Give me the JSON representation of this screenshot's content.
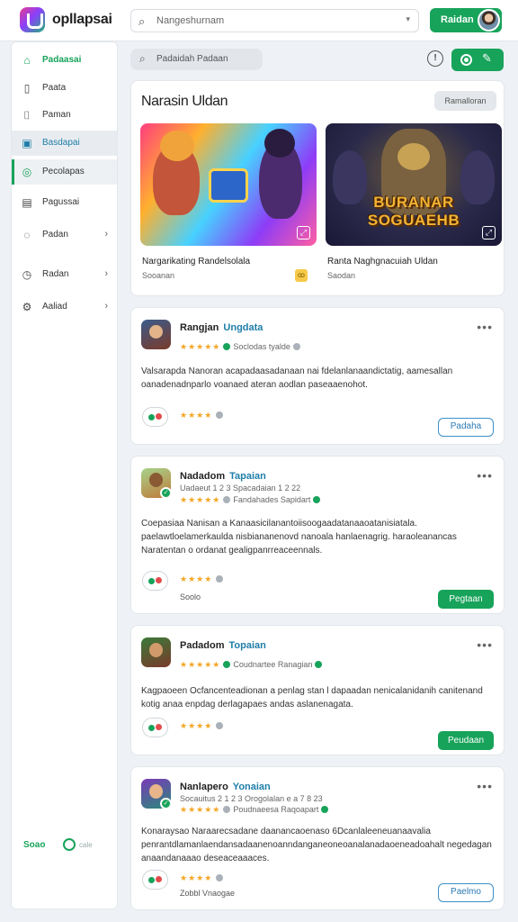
{
  "header": {
    "brand": "opllapsai",
    "search_placeholder": "Nangeshurnam",
    "action_label": "Raidan"
  },
  "sidebar": {
    "items": [
      {
        "label": "Padaasai",
        "icon": "home-icon",
        "arrow": ""
      },
      {
        "label": "Paata",
        "icon": "document-icon",
        "arrow": ""
      },
      {
        "label": "Paman",
        "icon": "folder-icon",
        "arrow": ""
      },
      {
        "label": "Basdapai",
        "icon": "calendar-icon",
        "arrow": ""
      },
      {
        "label": "Pecolapas",
        "icon": "shield-icon",
        "arrow": ""
      },
      {
        "label": "Pagussai",
        "icon": "list-icon",
        "arrow": ""
      },
      {
        "label": "Padan",
        "icon": "settings-icon",
        "arrow": "›"
      },
      {
        "label": "Radan",
        "icon": "clock-icon",
        "arrow": "›"
      },
      {
        "label": "Aaliad",
        "icon": "gear-icon",
        "arrow": "›"
      }
    ],
    "footer_label": "Soao",
    "footer_sub": "cale"
  },
  "toolbar": {
    "filter_placeholder": "Padaidah Padaan",
    "info_glyph": "!"
  },
  "featured": {
    "title": "Narasin Uldan",
    "button": "Ramalloran",
    "games": [
      {
        "name": "Nargarikating Randelsolala",
        "sub": "Sooanan",
        "badge": "ꝏ"
      },
      {
        "name": "Ranta Naghgnacuiah Uldan",
        "sub": "Saodan",
        "badge": ""
      }
    ],
    "game2_logo_text": "BURANAR SOGUAEHB"
  },
  "reviews": [
    {
      "name": "Rangjan",
      "tag": "Ungdata",
      "meta": "",
      "source": "Soclodas tyalde",
      "body": "Valsarapda Nanoran acapadaasadanaan nai fdelanlanaandictatig, aamesallan oanadenadnparlo voanaed ateran aodlan paseaaenohot.",
      "footer": "",
      "button": "Padaha",
      "button_style": "outline"
    },
    {
      "name": "Nadadom",
      "tag": "Tapaian",
      "meta": "Uadaeut 1 2 3 Spacadaian 1 2 22",
      "source": "Fandahades Sapidart",
      "body": "Coepasiaa Nanisan a Kanaasicilanantoiisoogaadatanaaoatanisiatala. paelawtloelamerkaulda nisbiananenovd nanoala hanlaenagrig. haraoleanancas Naratentan o ordanat gealigpanrreaceennals.",
      "footer": "Soolo",
      "button": "Pegtaan",
      "button_style": "filled"
    },
    {
      "name": "Padadom",
      "tag": "Topaian",
      "meta": "",
      "source": "Coudnartee Ranagian",
      "body": "Kagpaoeen Ocfancenteadionan a penlag stan l dapaadan nenicalanidanih canitenand kotig anaa enpdag derlagapaes andas aslanenagata.",
      "footer": "",
      "button": "Peudaan",
      "button_style": "filled"
    },
    {
      "name": "Nanlapero",
      "tag": "Yonaian",
      "meta": "Socauitus 2 1 2 3 Orogolalan e a 7 8 23",
      "source": "Poudnaeesa Raqoapart",
      "body": "Konaraysao Naraarecsadane daanancaoenaso 6Dcanlaleeneuanaavalia penrantdlamanlaendansadaanenoanndanganeoneoanalanadaoeneadoahalt negedagan anaandanaaao deseaceaaaces.",
      "footer": "Zobbl Vnaogae",
      "button": "Paelmo",
      "button_style": "outline"
    }
  ],
  "colors": {
    "accent": "#17a35a",
    "link": "#1f7ea8",
    "star": "#f4a623"
  }
}
